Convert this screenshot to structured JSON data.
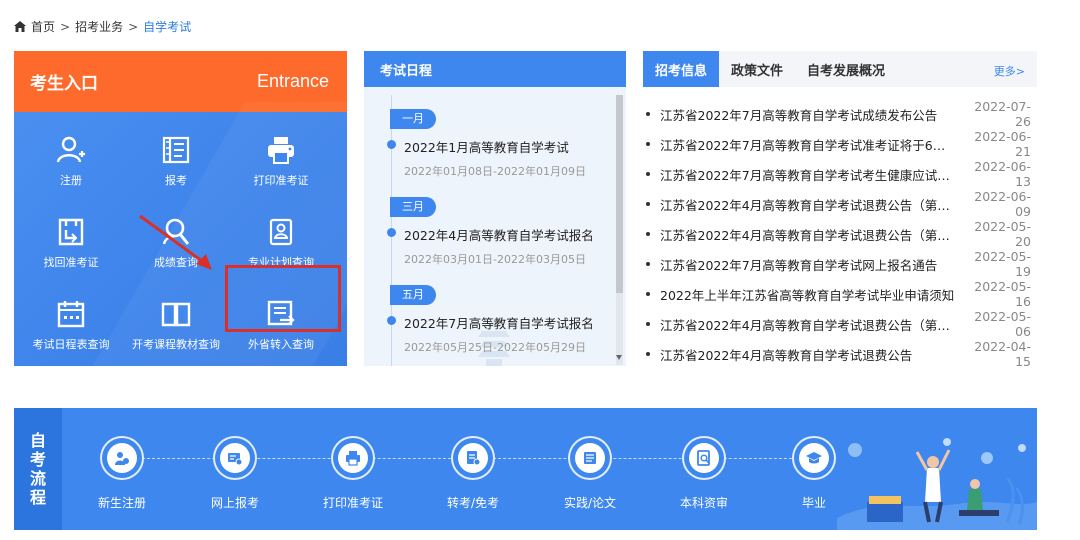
{
  "breadcrumb": {
    "home": "首页",
    "sep": ">",
    "items": [
      "招考业务",
      "自学考试"
    ]
  },
  "entrance": {
    "title": "考生入口",
    "title_en": "Entrance",
    "items": [
      {
        "label": "注册",
        "icon": "user-add-icon"
      },
      {
        "label": "报考",
        "icon": "form-list-icon"
      },
      {
        "label": "打印准考证",
        "icon": "printer-icon"
      },
      {
        "label": "找回准考证",
        "icon": "recover-card-icon"
      },
      {
        "label": "成绩查询",
        "icon": "search-user-icon"
      },
      {
        "label": "专业计划查询",
        "icon": "id-card-icon"
      },
      {
        "label": "考试日程表查询",
        "icon": "calendar-icon"
      },
      {
        "label": "开考课程教材查询",
        "icon": "book-icon"
      },
      {
        "label": "外省转入查询",
        "icon": "transfer-icon"
      }
    ],
    "highlight_color": "#d9302c"
  },
  "schedule": {
    "title": "考试日程",
    "entries": [
      {
        "month": "一月",
        "title": "2022年1月高等教育自学考试",
        "date": "2022年01月08日-2022年01月09日"
      },
      {
        "month": "三月",
        "title": "2022年4月高等教育自学考试报名",
        "date": "2022年03月01日-2022年03月05日"
      },
      {
        "month": "五月",
        "title": "2022年7月高等教育自学考试报名",
        "date": "2022年05月25日-2022年05月29日"
      }
    ]
  },
  "news": {
    "tabs": [
      {
        "label": "招考信息",
        "active": true
      },
      {
        "label": "政策文件",
        "active": false
      },
      {
        "label": "自考发展概况",
        "active": false
      }
    ],
    "more": "更多>",
    "items": [
      {
        "title": "江苏省2022年7月高等教育自学考试成绩发布公告",
        "date": "2022-07-26"
      },
      {
        "title": "江苏省2022年7月高等教育自学考试准考证将于6月2...",
        "date": "2022-06-21"
      },
      {
        "title": "江苏省2022年7月高等教育自学考试考生健康应试须知",
        "date": "2022-06-13"
      },
      {
        "title": "江苏省2022年4月高等教育自学考试退费公告（第四...",
        "date": "2022-06-09"
      },
      {
        "title": "江苏省2022年4月高等教育自学考试退费公告（第三...",
        "date": "2022-05-20"
      },
      {
        "title": "江苏省2022年7月高等教育自学考试网上报名通告",
        "date": "2022-05-19"
      },
      {
        "title": "2022年上半年江苏省高等教育自学考试毕业申请须知",
        "date": "2022-05-16"
      },
      {
        "title": "江苏省2022年4月高等教育自学考试退费公告（第二...",
        "date": "2022-05-06"
      },
      {
        "title": "江苏省2022年4月高等教育自学考试退费公告",
        "date": "2022-04-15"
      }
    ]
  },
  "process": {
    "label": [
      "自",
      "考",
      "流",
      "程"
    ],
    "steps": [
      {
        "label": "新生注册",
        "icon": "new-student-icon"
      },
      {
        "label": "网上报考",
        "icon": "online-apply-icon"
      },
      {
        "label": "打印准考证",
        "icon": "print-card-icon"
      },
      {
        "label": "转考/免考",
        "icon": "transfer-exempt-icon"
      },
      {
        "label": "实践/论文",
        "icon": "practice-thesis-icon"
      },
      {
        "label": "本科资审",
        "icon": "review-icon"
      },
      {
        "label": "毕业",
        "icon": "graduation-cap-icon"
      }
    ]
  },
  "colors": {
    "primary": "#3d87ee",
    "orange": "#fd6a2b",
    "link": "#2f7de1"
  }
}
